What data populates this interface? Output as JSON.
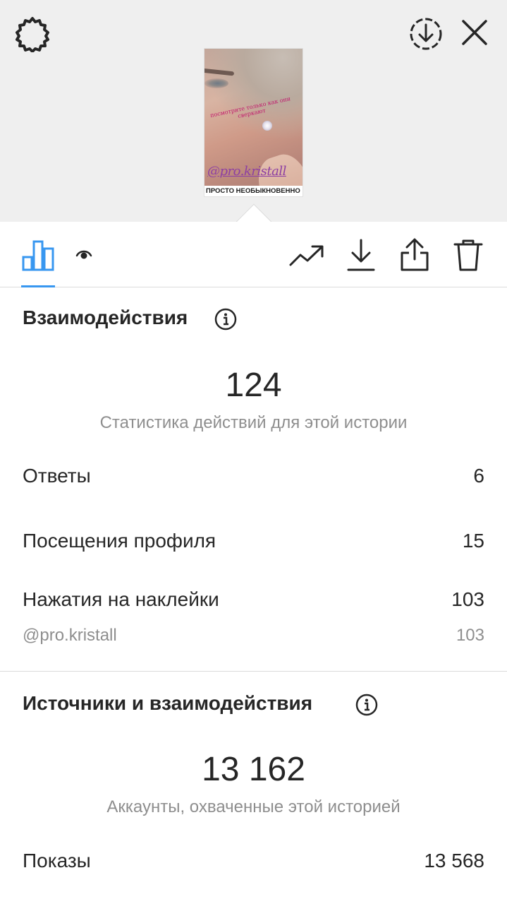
{
  "story_preview": {
    "caption": "посмотрите только как они сверкают",
    "mention": "@pro.kristall",
    "bottom_text": "ПРОСТО НЕОБЫКНОВЕННО"
  },
  "icons": {
    "settings": "gear-icon",
    "save": "download-circle-icon",
    "close": "close-icon",
    "insights_tab": "bar-chart-icon",
    "viewers_tab": "eye-icon",
    "promote": "trending-up-icon",
    "download": "download-icon",
    "share": "share-icon",
    "delete": "trash-icon",
    "info": "info-icon"
  },
  "colors": {
    "accent": "#3897f0",
    "text": "#262626",
    "muted": "#8e8e8e"
  },
  "interactions": {
    "title": "Взаимодействия",
    "total": "124",
    "caption": "Статистика действий для этой истории",
    "rows": [
      {
        "label": "Ответы",
        "value": "6"
      },
      {
        "label": "Посещения профиля",
        "value": "15"
      },
      {
        "label": "Нажатия на наклейки",
        "value": "103"
      }
    ],
    "sticker_sub": {
      "label": "@pro.kristall",
      "value": "103"
    }
  },
  "discovery": {
    "title": "Источники и взаимодействия",
    "total": "13 162",
    "caption": "Аккаунты, охваченные этой историей",
    "rows": [
      {
        "label": "Показы",
        "value": "13 568"
      }
    ]
  }
}
